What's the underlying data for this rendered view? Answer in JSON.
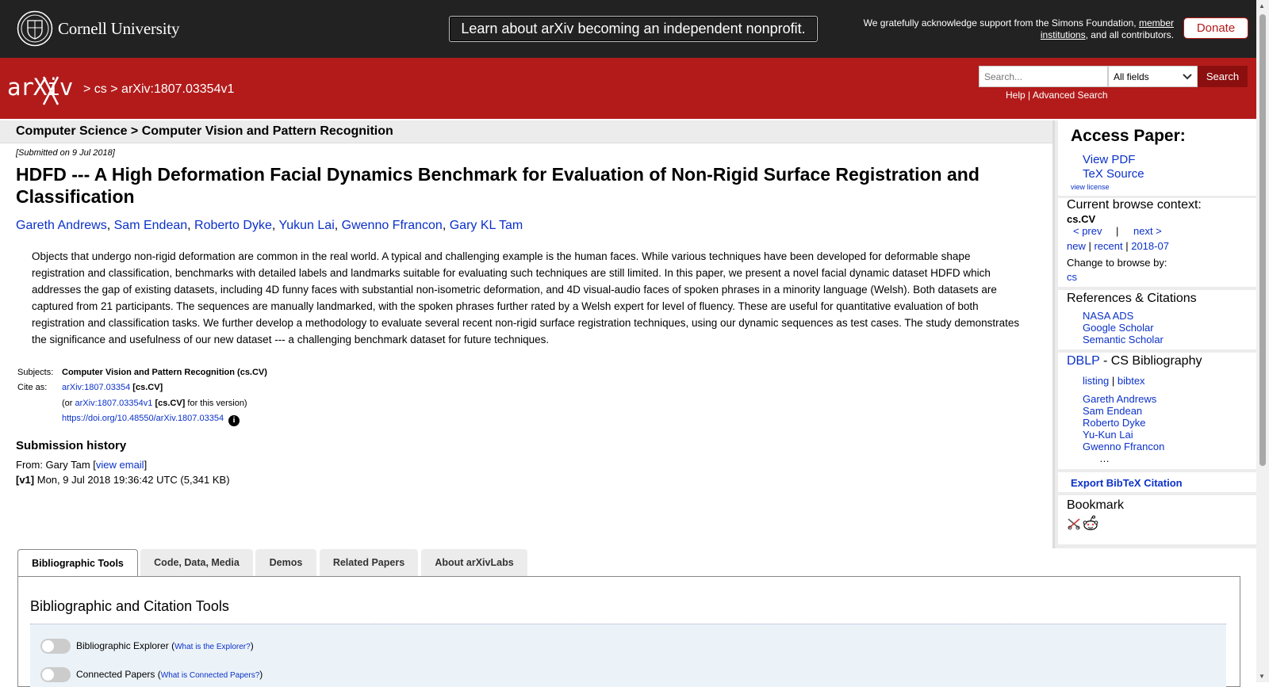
{
  "header": {
    "university": "Cornell University",
    "announcement": "Learn about arXiv becoming an independent nonprofit.",
    "ack_prefix": "We gratefully acknowledge support from the Simons Foundation,",
    "ack_link1": "member",
    "ack_link2": "institutions",
    "ack_suffix": ", and all contributors.",
    "donate": "Donate"
  },
  "nav": {
    "logo": "arXiv",
    "sep1": ">",
    "crumb_cs": "cs",
    "sep2": ">",
    "crumb_id": "arXiv:1807.03354v1",
    "search_placeholder": "Search...",
    "field_select": "All fields",
    "search_button": "Search",
    "help": "Help",
    "pipe": "|",
    "advanced": "Advanced Search"
  },
  "paper": {
    "subject_header": "Computer Science > Computer Vision and Pattern Recognition",
    "submitted": "[Submitted on 9 Jul 2018]",
    "title": "HDFD --- A High Deformation Facial Dynamics Benchmark for Evaluation of Non-Rigid Surface Registration and Classification",
    "authors": [
      "Gareth Andrews",
      "Sam Endean",
      "Roberto Dyke",
      "Yukun Lai",
      "Gwenno Ffrancon",
      "Gary KL Tam"
    ],
    "abstract": "Objects that undergo non-rigid deformation are common in the real world. A typical and challenging example is the human faces. While various techniques have been developed for deformable shape registration and classification, benchmarks with detailed labels and landmarks suitable for evaluating such techniques are still limited. In this paper, we present a novel facial dynamic dataset HDFD which addresses the gap of existing datasets, including 4D funny faces with substantial non-isometric deformation, and 4D visual-audio faces of spoken phrases in a minority language (Welsh). Both datasets are captured from 21 participants. The sequences are manually landmarked, with the spoken phrases further rated by a Welsh expert for level of fluency. These are useful for quantitative evaluation of both registration and classification tasks. We further develop a methodology to evaluate several recent non-rigid surface registration techniques, using our dynamic sequences as test cases. The study demonstrates the significance and usefulness of our new dataset --- a challenging benchmark dataset for future techniques.",
    "subjects_label": "Subjects:",
    "subjects_value": "Computer Vision and Pattern Recognition (cs.CV)",
    "cite_label": "Cite as:",
    "cite_id": "arXiv:1807.03354",
    "cite_cat": "[cs.CV]",
    "cite_or": "(or",
    "cite_version": "arXiv:1807.03354v1",
    "cite_version_cat": "[cs.CV]",
    "cite_version_suffix": "for this version)",
    "doi": "https://doi.org/10.48550/arXiv.1807.03354",
    "history_title": "Submission history",
    "from_prefix": "From: Gary Tam [",
    "from_link": "view email",
    "from_suffix": "]",
    "v1_label": "[v1]",
    "v1_text": "Mon, 9 Jul 2018 19:36:42 UTC (5,341 KB)"
  },
  "sidebar": {
    "access_title": "Access Paper:",
    "view_pdf": "View PDF",
    "tex_source": "TeX Source",
    "view_license": "view license",
    "browse_title": "Current browse context:",
    "browse_cat": "cs.CV",
    "prev": "< prev",
    "bar": "|",
    "next": "next >",
    "new": "new",
    "recent": "recent",
    "month": "2018-07",
    "change_browse": "Change to browse by:",
    "browse_cs": "cs",
    "refs_title": "References & Citations",
    "nasa": "NASA ADS",
    "google": "Google Scholar",
    "semantic": "Semantic Scholar",
    "dblp": "DBLP",
    "dblp_suffix": " - CS Bibliography",
    "listing": "listing",
    "bibtex": "bibtex",
    "dblp_authors": [
      "Gareth Andrews",
      "Sam Endean",
      "Roberto Dyke",
      "Yu-Kun Lai",
      "Gwenno Ffrancon"
    ],
    "ellipsis": "…",
    "export": "Export BibTeX Citation",
    "bookmark": "Bookmark"
  },
  "tabs": {
    "items": [
      "Bibliographic Tools",
      "Code, Data, Media",
      "Demos",
      "Related Papers",
      "About arXivLabs"
    ],
    "panel_title": "Bibliographic and Citation Tools",
    "explorer_label": "Bibliographic Explorer",
    "explorer_help": "What is the Explorer?",
    "connected_label": "Connected Papers",
    "connected_help": "What is Connected Papers?"
  }
}
